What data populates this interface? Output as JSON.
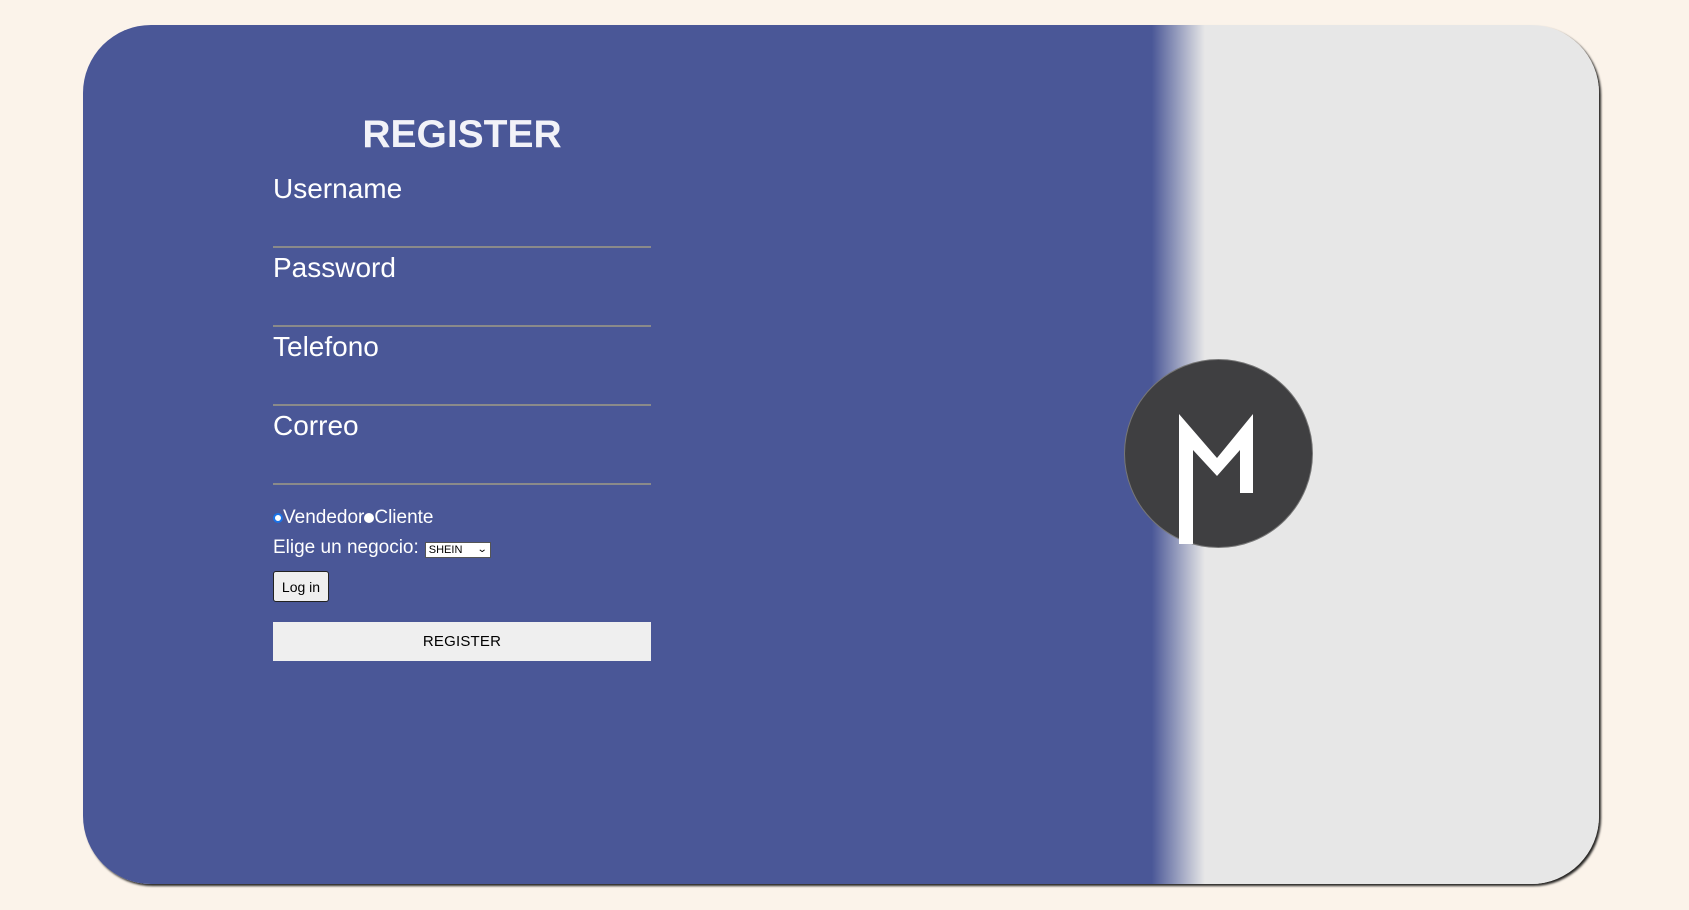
{
  "form": {
    "title": "REGISTER",
    "fields": {
      "username_placeholder": "Username",
      "password_placeholder": "Password",
      "phone_placeholder": "Telefono",
      "email_placeholder": "Correo"
    },
    "role": {
      "options": [
        "Vendedor",
        "Cliente"
      ],
      "selected": "Vendedor"
    },
    "business": {
      "label": "Elige un negocio:",
      "selected": "SHEIN"
    },
    "login_label": "Log in",
    "register_label": "REGISTER"
  },
  "logo": {
    "letter": "M",
    "icon": "m-logo-icon"
  },
  "colors": {
    "background": "#fbf3ea",
    "panel": "#4a5797",
    "right_panel": "#e7e7e7",
    "logo_circle": "#3f3f41"
  }
}
